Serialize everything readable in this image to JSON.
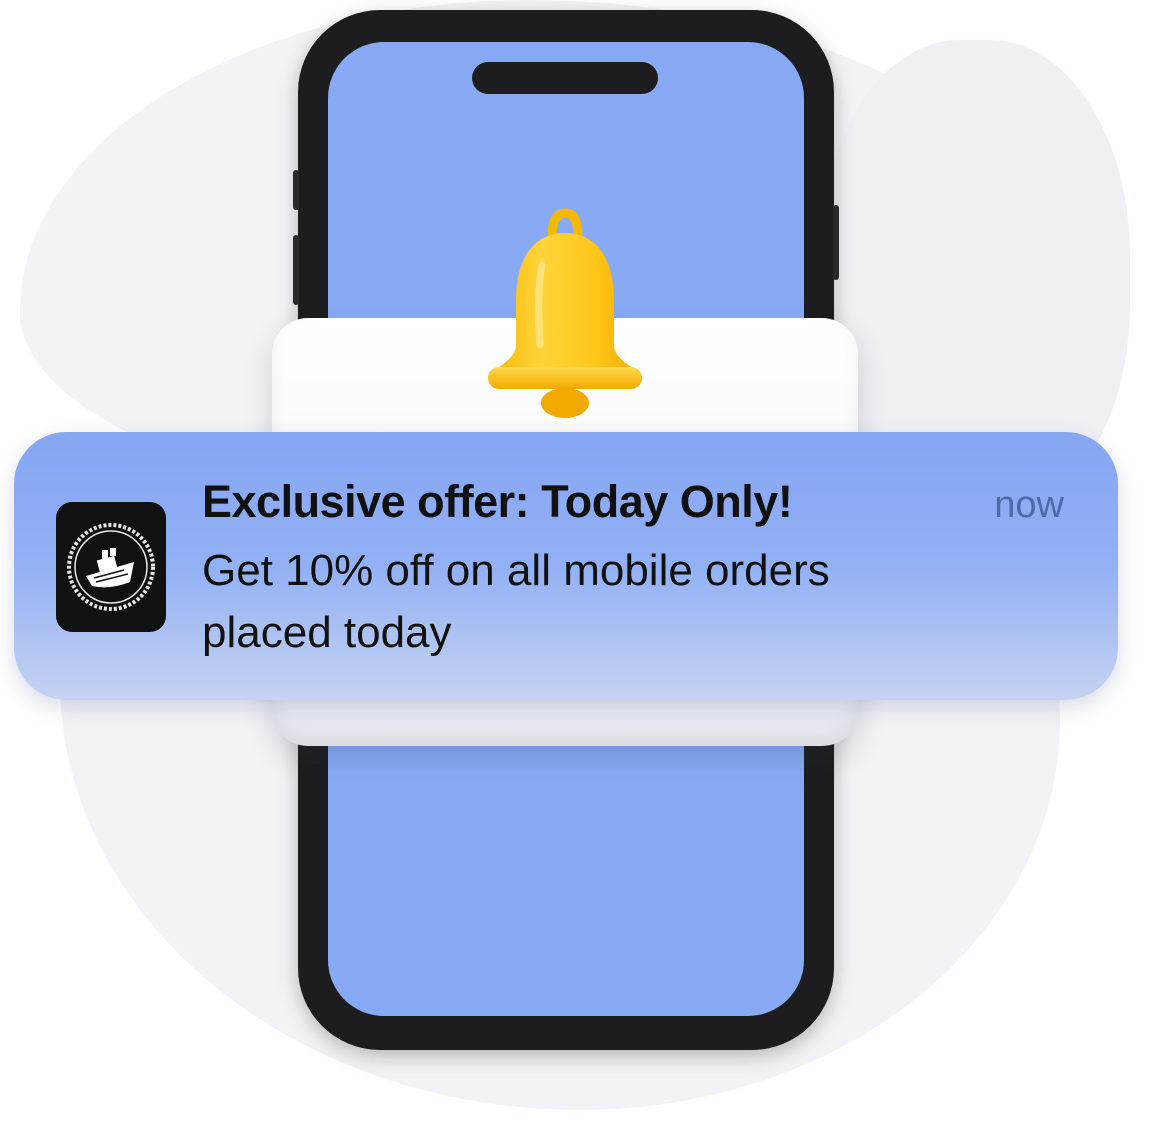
{
  "notification": {
    "title": "Exclusive offer: Today Only!",
    "body_line1": "Get 10% off on all mobile orders",
    "body_line2": "placed today",
    "time": "now",
    "app_icon": "ship-logo-icon"
  },
  "decor": {
    "bell_icon": "bell-icon",
    "phone": "smartphone"
  },
  "colors": {
    "screen": "#88aaf5",
    "notification_top": "#86a6f3",
    "bell": "#ffc928",
    "phone_frame": "#1d1d1f"
  }
}
